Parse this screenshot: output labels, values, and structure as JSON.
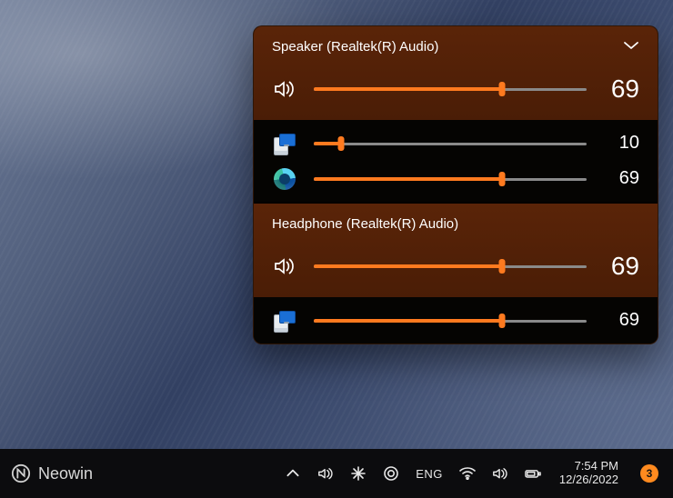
{
  "flyout": {
    "devices": [
      {
        "label": "Speaker (Realtek(R) Audio)",
        "has_dropdown": true,
        "volume": 69,
        "apps": [
          {
            "icon": "system-sounds",
            "name": "System Sounds",
            "volume": 10
          },
          {
            "icon": "edge",
            "name": "Microsoft Edge",
            "volume": 69
          }
        ]
      },
      {
        "label": "Headphone (Realtek(R) Audio)",
        "has_dropdown": false,
        "volume": 69,
        "apps": [
          {
            "icon": "system-sounds",
            "name": "System Sounds",
            "volume": 69
          }
        ]
      }
    ]
  },
  "taskbar": {
    "watermark": "Neowin",
    "language": "ENG",
    "time": "7:54 PM",
    "date": "12/26/2022",
    "notification_count": 3
  },
  "colors": {
    "accent": "#ff7a1f"
  }
}
